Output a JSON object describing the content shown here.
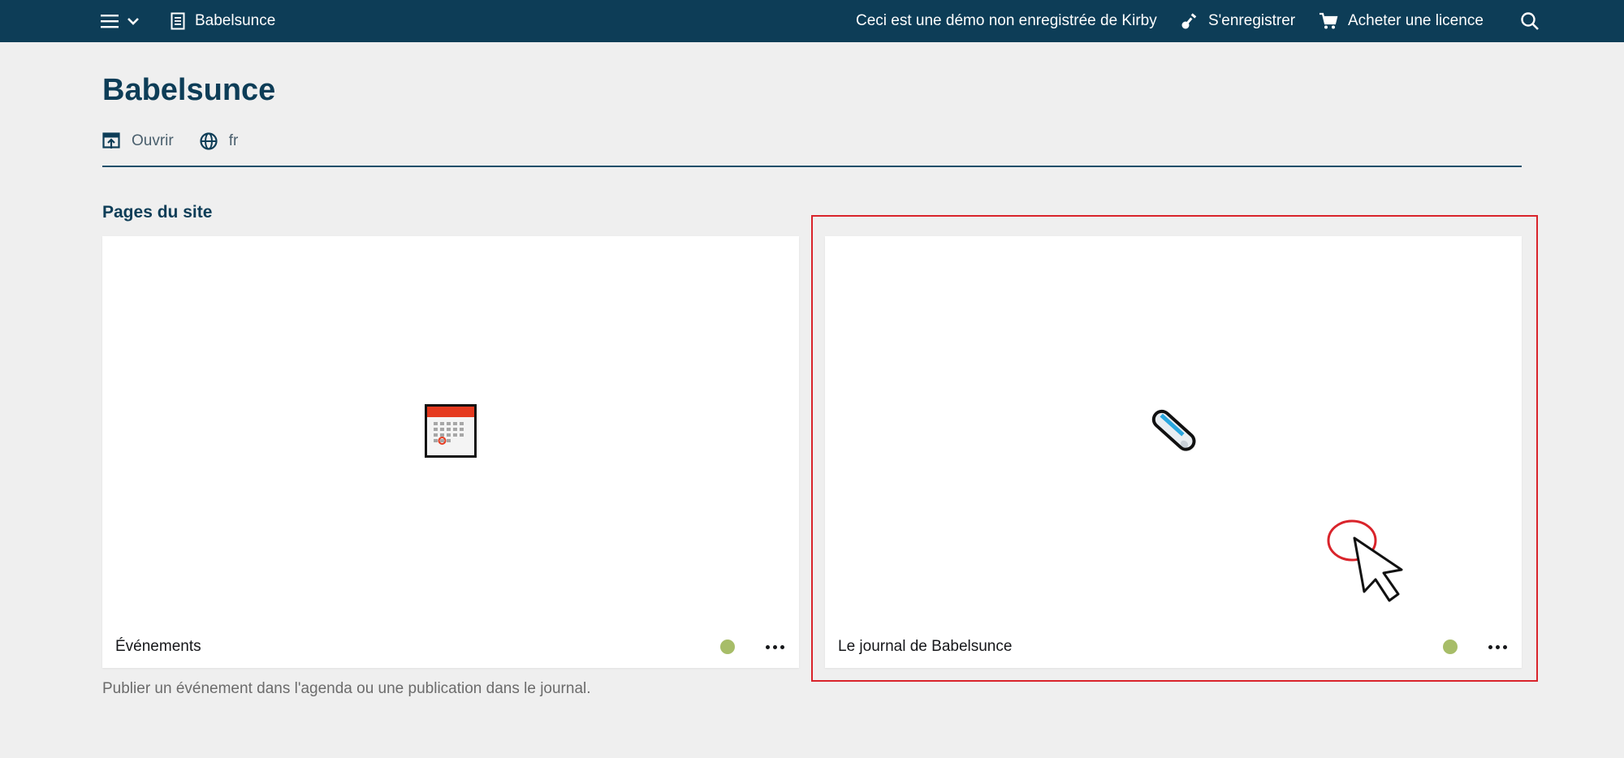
{
  "topbar": {
    "site_title": "Babelsunce",
    "demo_notice": "Ceci est une démo non enregistrée de Kirby",
    "register_label": "S'enregistrer",
    "buy_label": "Acheter une licence",
    "bg_color": "#0d3d57",
    "notice_color": "#f06a6a"
  },
  "header": {
    "title": "Babelsunce",
    "open_label": "Ouvrir",
    "language_label": "fr"
  },
  "section": {
    "label": "Pages du site",
    "help": "Publier un événement dans l'agenda ou une publication dans le journal."
  },
  "cards": [
    {
      "label": "Événements",
      "icon": "calendar-icon",
      "status_color": "#a7bd68"
    },
    {
      "label": "Le journal de Babelsunce",
      "icon": "crayon-icon",
      "status_color": "#a7bd68"
    }
  ],
  "annotation_color": "#d9242b"
}
